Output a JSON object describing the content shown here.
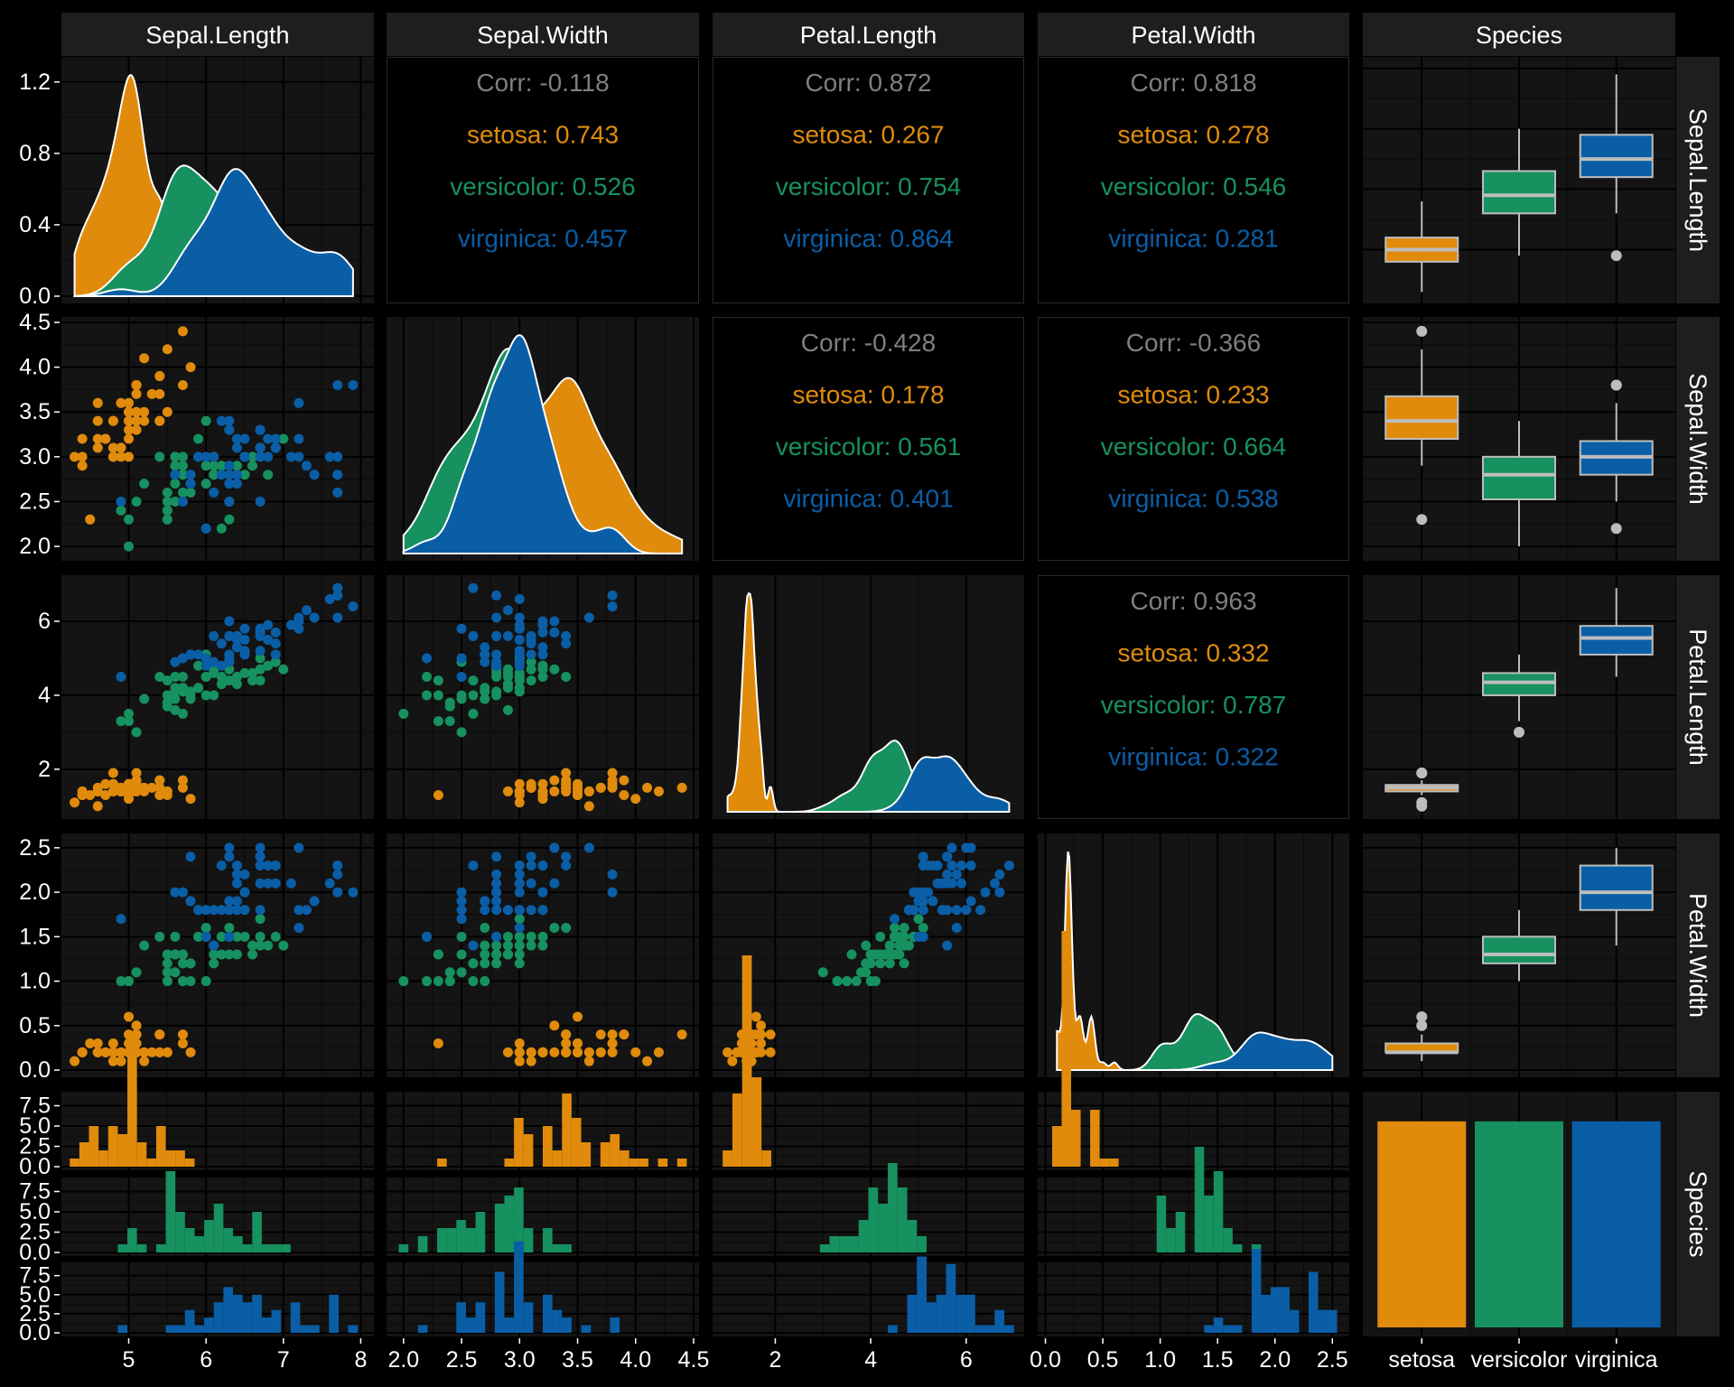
{
  "chart_data": {
    "type": "pairs",
    "variables": [
      "Sepal.Length",
      "Sepal.Width",
      "Petal.Length",
      "Petal.Width",
      "Species"
    ],
    "species": [
      "setosa",
      "versicolor",
      "virginica"
    ],
    "colors": {
      "setosa": "#e08b0c",
      "versicolor": "#16915f",
      "virginica": "#0a5ea6",
      "corr_overall": "#7f7f7f",
      "panel_bg": "#141414",
      "strip_bg": "#1e1e1e",
      "grid_major": "#000000",
      "grid_minor": "#0b0b0b",
      "page_bg": "#000000"
    },
    "correlations": [
      {
        "id": "sw-sl",
        "overall": "Corr: -0.118",
        "setosa": "setosa: 0.743",
        "versicolor": "versicolor: 0.526",
        "virginica": "virginica: 0.457"
      },
      {
        "id": "pl-sl",
        "overall": "Corr: 0.872",
        "setosa": "setosa: 0.267",
        "versicolor": "versicolor: 0.754",
        "virginica": "virginica: 0.864"
      },
      {
        "id": "pw-sl",
        "overall": "Corr: 0.818",
        "setosa": "setosa: 0.278",
        "versicolor": "versicolor: 0.546",
        "virginica": "virginica: 0.281"
      },
      {
        "id": "pl-sw",
        "overall": "Corr: -0.428",
        "setosa": "setosa: 0.178",
        "versicolor": "versicolor: 0.561",
        "virginica": "virginica: 0.401"
      },
      {
        "id": "pw-sw",
        "overall": "Corr: -0.366",
        "setosa": "setosa: 0.233",
        "versicolor": "versicolor: 0.664",
        "virginica": "virginica: 0.538"
      },
      {
        "id": "pw-pl",
        "overall": "Corr: 0.963",
        "setosa": "setosa: 0.332",
        "versicolor": "versicolor: 0.787",
        "virginica": "virginica: 0.322"
      }
    ],
    "axes": {
      "sl": {
        "range": [
          4.2,
          8.1
        ],
        "ticks": [
          5,
          6,
          7,
          8
        ],
        "labels": [
          "5",
          "6",
          "7",
          "8"
        ]
      },
      "sw": {
        "range": [
          1.9,
          4.5
        ],
        "ticks": [
          2.0,
          2.5,
          3.0,
          3.5,
          4.0,
          4.5
        ],
        "labels": [
          "2.0",
          "2.5",
          "3.0",
          "3.5",
          "4.0",
          "4.5"
        ]
      },
      "pl": {
        "range": [
          0.8,
          7.1
        ],
        "ticks": [
          2,
          4,
          6
        ],
        "labels": [
          "2",
          "4",
          "6"
        ]
      },
      "pw": {
        "range": [
          -0.02,
          2.6
        ],
        "ticks": [
          0.0,
          0.5,
          1.0,
          1.5,
          2.0,
          2.5
        ],
        "labels": [
          "0.0",
          "0.5",
          "1.0",
          "1.5",
          "2.0",
          "2.5"
        ]
      },
      "dens_sl": {
        "range": [
          0,
          1.3
        ],
        "ticks": [
          0.0,
          0.4,
          0.8,
          1.2
        ],
        "labels": [
          "0.0",
          "0.4",
          "0.8",
          "1.2"
        ]
      },
      "count": {
        "range": [
          0,
          9
        ],
        "ticks": [
          0.0,
          2.5,
          5.0,
          7.5
        ],
        "labels": [
          "0.0",
          "2.5",
          "5.0",
          "7.5"
        ]
      }
    },
    "species_axis_labels": [
      "setosa",
      "versicolor",
      "virginica"
    ],
    "species_counts": [
      50,
      50,
      50
    ],
    "boxplots": {
      "sl": {
        "setosa": [
          4.3,
          4.8,
          5.0,
          5.2,
          5.8
        ],
        "versicolor": [
          4.9,
          5.6,
          5.9,
          6.3,
          7.0
        ],
        "virginica": [
          5.6,
          6.2,
          6.5,
          6.9,
          7.9
        ]
      },
      "sw": {
        "setosa": [
          2.9,
          3.2,
          3.4,
          3.675,
          4.2
        ],
        "versicolor": [
          2.0,
          2.525,
          2.8,
          3.0,
          3.4
        ],
        "virginica": [
          2.5,
          2.8,
          3.0,
          3.175,
          3.6
        ]
      },
      "pl": {
        "setosa": [
          1.3,
          1.4,
          1.5,
          1.575,
          1.7
        ],
        "versicolor": [
          3.3,
          4.0,
          4.35,
          4.6,
          5.1
        ],
        "virginica": [
          4.5,
          5.1,
          5.55,
          5.875,
          6.9
        ]
      },
      "pw": {
        "setosa": [
          0.1,
          0.2,
          0.2,
          0.3,
          0.4
        ],
        "versicolor": [
          1.0,
          1.2,
          1.3,
          1.5,
          1.8
        ],
        "virginica": [
          1.4,
          1.8,
          2.0,
          2.3,
          2.5
        ]
      }
    },
    "box_outliers": {
      "sl": {
        "setosa": [],
        "versicolor": [],
        "virginica": [
          4.9
        ]
      },
      "sw": {
        "setosa": [
          2.3,
          4.4
        ],
        "versicolor": [],
        "virginica": [
          2.2,
          3.8,
          3.8
        ]
      },
      "pl": {
        "setosa": [
          1.0,
          1.1,
          1.9,
          1.9
        ],
        "versicolor": [
          3.0
        ],
        "virginica": []
      },
      "pw": {
        "setosa": [
          0.5,
          0.6
        ],
        "versicolor": [],
        "virginica": []
      }
    },
    "iris": {
      "setosa": [
        [
          5.1,
          3.5,
          1.4,
          0.2
        ],
        [
          4.9,
          3.0,
          1.4,
          0.2
        ],
        [
          4.7,
          3.2,
          1.3,
          0.2
        ],
        [
          4.6,
          3.1,
          1.5,
          0.2
        ],
        [
          5.0,
          3.6,
          1.4,
          0.2
        ],
        [
          5.4,
          3.9,
          1.7,
          0.4
        ],
        [
          4.6,
          3.4,
          1.4,
          0.3
        ],
        [
          5.0,
          3.4,
          1.5,
          0.2
        ],
        [
          4.4,
          2.9,
          1.4,
          0.2
        ],
        [
          4.9,
          3.1,
          1.5,
          0.1
        ],
        [
          5.4,
          3.7,
          1.5,
          0.2
        ],
        [
          4.8,
          3.4,
          1.6,
          0.2
        ],
        [
          4.8,
          3.0,
          1.4,
          0.1
        ],
        [
          4.3,
          3.0,
          1.1,
          0.1
        ],
        [
          5.8,
          4.0,
          1.2,
          0.2
        ],
        [
          5.7,
          4.4,
          1.5,
          0.4
        ],
        [
          5.4,
          3.9,
          1.3,
          0.4
        ],
        [
          5.1,
          3.5,
          1.4,
          0.3
        ],
        [
          5.7,
          3.8,
          1.7,
          0.3
        ],
        [
          5.1,
          3.8,
          1.5,
          0.3
        ],
        [
          5.4,
          3.4,
          1.7,
          0.2
        ],
        [
          5.1,
          3.7,
          1.5,
          0.4
        ],
        [
          4.6,
          3.6,
          1.0,
          0.2
        ],
        [
          5.1,
          3.3,
          1.7,
          0.5
        ],
        [
          4.8,
          3.4,
          1.9,
          0.2
        ],
        [
          5.0,
          3.0,
          1.6,
          0.2
        ],
        [
          5.0,
          3.4,
          1.6,
          0.4
        ],
        [
          5.2,
          3.5,
          1.5,
          0.2
        ],
        [
          5.2,
          3.4,
          1.4,
          0.2
        ],
        [
          4.7,
          3.2,
          1.6,
          0.2
        ],
        [
          4.8,
          3.1,
          1.6,
          0.2
        ],
        [
          5.4,
          3.4,
          1.5,
          0.4
        ],
        [
          5.2,
          4.1,
          1.5,
          0.1
        ],
        [
          5.5,
          4.2,
          1.4,
          0.2
        ],
        [
          4.9,
          3.1,
          1.5,
          0.2
        ],
        [
          5.0,
          3.2,
          1.2,
          0.2
        ],
        [
          5.5,
          3.5,
          1.3,
          0.2
        ],
        [
          4.9,
          3.6,
          1.4,
          0.1
        ],
        [
          4.4,
          3.0,
          1.3,
          0.2
        ],
        [
          5.1,
          3.4,
          1.5,
          0.2
        ],
        [
          5.0,
          3.5,
          1.3,
          0.3
        ],
        [
          4.5,
          2.3,
          1.3,
          0.3
        ],
        [
          4.4,
          3.2,
          1.3,
          0.2
        ],
        [
          5.0,
          3.5,
          1.6,
          0.6
        ],
        [
          5.1,
          3.8,
          1.9,
          0.4
        ],
        [
          4.8,
          3.0,
          1.4,
          0.3
        ],
        [
          5.1,
          3.8,
          1.6,
          0.2
        ],
        [
          4.6,
          3.2,
          1.4,
          0.2
        ],
        [
          5.3,
          3.7,
          1.5,
          0.2
        ],
        [
          5.0,
          3.3,
          1.4,
          0.2
        ]
      ],
      "versicolor": [
        [
          7.0,
          3.2,
          4.7,
          1.4
        ],
        [
          6.4,
          3.2,
          4.5,
          1.5
        ],
        [
          6.9,
          3.1,
          4.9,
          1.5
        ],
        [
          5.5,
          2.3,
          4.0,
          1.3
        ],
        [
          6.5,
          2.8,
          4.6,
          1.5
        ],
        [
          5.7,
          2.8,
          4.5,
          1.3
        ],
        [
          6.3,
          3.3,
          4.7,
          1.6
        ],
        [
          4.9,
          2.4,
          3.3,
          1.0
        ],
        [
          6.6,
          2.9,
          4.6,
          1.3
        ],
        [
          5.2,
          2.7,
          3.9,
          1.4
        ],
        [
          5.0,
          2.0,
          3.5,
          1.0
        ],
        [
          5.9,
          3.0,
          4.2,
          1.5
        ],
        [
          6.0,
          2.2,
          4.0,
          1.0
        ],
        [
          6.1,
          2.9,
          4.7,
          1.4
        ],
        [
          5.6,
          2.9,
          3.6,
          1.3
        ],
        [
          6.7,
          3.1,
          4.4,
          1.4
        ],
        [
          5.6,
          3.0,
          4.5,
          1.5
        ],
        [
          5.8,
          2.7,
          4.1,
          1.0
        ],
        [
          6.2,
          2.2,
          4.5,
          1.5
        ],
        [
          5.6,
          2.5,
          3.9,
          1.1
        ],
        [
          5.9,
          3.2,
          4.8,
          1.8
        ],
        [
          6.1,
          2.8,
          4.0,
          1.3
        ],
        [
          6.3,
          2.5,
          4.9,
          1.5
        ],
        [
          6.1,
          2.8,
          4.7,
          1.2
        ],
        [
          6.4,
          2.9,
          4.3,
          1.3
        ],
        [
          6.6,
          3.0,
          4.4,
          1.4
        ],
        [
          6.8,
          2.8,
          4.8,
          1.4
        ],
        [
          6.7,
          3.0,
          5.0,
          1.7
        ],
        [
          6.0,
          2.9,
          4.5,
          1.5
        ],
        [
          5.7,
          2.6,
          3.5,
          1.0
        ],
        [
          5.5,
          2.4,
          3.8,
          1.1
        ],
        [
          5.5,
          2.4,
          3.7,
          1.0
        ],
        [
          5.8,
          2.7,
          3.9,
          1.2
        ],
        [
          6.0,
          2.7,
          5.1,
          1.6
        ],
        [
          5.4,
          3.0,
          4.5,
          1.5
        ],
        [
          6.0,
          3.4,
          4.5,
          1.6
        ],
        [
          6.7,
          3.1,
          4.7,
          1.5
        ],
        [
          6.3,
          2.3,
          4.4,
          1.3
        ],
        [
          5.6,
          3.0,
          4.1,
          1.3
        ],
        [
          5.5,
          2.5,
          4.0,
          1.3
        ],
        [
          5.5,
          2.6,
          4.4,
          1.2
        ],
        [
          6.1,
          3.0,
          4.6,
          1.4
        ],
        [
          5.8,
          2.6,
          4.0,
          1.2
        ],
        [
          5.0,
          2.3,
          3.3,
          1.0
        ],
        [
          5.6,
          2.7,
          4.2,
          1.3
        ],
        [
          5.7,
          3.0,
          4.2,
          1.2
        ],
        [
          5.7,
          2.9,
          4.2,
          1.3
        ],
        [
          6.2,
          2.9,
          4.3,
          1.3
        ],
        [
          5.1,
          2.5,
          3.0,
          1.1
        ],
        [
          5.7,
          2.8,
          4.1,
          1.3
        ]
      ],
      "virginica": [
        [
          6.3,
          3.3,
          6.0,
          2.5
        ],
        [
          5.8,
          2.7,
          5.1,
          1.9
        ],
        [
          7.1,
          3.0,
          5.9,
          2.1
        ],
        [
          6.3,
          2.9,
          5.6,
          1.8
        ],
        [
          6.5,
          3.0,
          5.8,
          2.2
        ],
        [
          7.6,
          3.0,
          6.6,
          2.1
        ],
        [
          4.9,
          2.5,
          4.5,
          1.7
        ],
        [
          7.3,
          2.9,
          6.3,
          1.8
        ],
        [
          6.7,
          2.5,
          5.8,
          1.8
        ],
        [
          7.2,
          3.6,
          6.1,
          2.5
        ],
        [
          6.5,
          3.2,
          5.1,
          2.0
        ],
        [
          6.4,
          2.7,
          5.3,
          1.9
        ],
        [
          6.8,
          3.0,
          5.5,
          2.1
        ],
        [
          5.7,
          2.5,
          5.0,
          2.0
        ],
        [
          5.8,
          2.8,
          5.1,
          2.4
        ],
        [
          6.4,
          3.2,
          5.3,
          2.3
        ],
        [
          6.5,
          3.0,
          5.5,
          1.8
        ],
        [
          7.7,
          3.8,
          6.7,
          2.2
        ],
        [
          7.7,
          2.6,
          6.9,
          2.3
        ],
        [
          6.0,
          2.2,
          5.0,
          1.5
        ],
        [
          6.9,
          3.2,
          5.7,
          2.3
        ],
        [
          5.6,
          2.8,
          4.9,
          2.0
        ],
        [
          7.7,
          2.8,
          6.7,
          2.0
        ],
        [
          6.3,
          2.7,
          4.9,
          1.8
        ],
        [
          6.7,
          3.3,
          5.7,
          2.1
        ],
        [
          7.2,
          3.2,
          6.0,
          1.8
        ],
        [
          6.2,
          2.8,
          4.8,
          1.8
        ],
        [
          6.1,
          3.0,
          4.9,
          1.8
        ],
        [
          6.4,
          2.8,
          5.6,
          2.1
        ],
        [
          7.2,
          3.0,
          5.8,
          1.6
        ],
        [
          7.4,
          2.8,
          6.1,
          1.9
        ],
        [
          7.9,
          3.8,
          6.4,
          2.0
        ],
        [
          6.4,
          2.8,
          5.6,
          2.2
        ],
        [
          6.3,
          2.8,
          5.1,
          1.5
        ],
        [
          6.1,
          2.6,
          5.6,
          1.4
        ],
        [
          7.7,
          3.0,
          6.1,
          2.3
        ],
        [
          6.3,
          3.4,
          5.6,
          2.4
        ],
        [
          6.4,
          3.1,
          5.5,
          1.8
        ],
        [
          6.0,
          3.0,
          4.8,
          1.8
        ],
        [
          6.9,
          3.1,
          5.4,
          2.1
        ],
        [
          6.7,
          3.1,
          5.6,
          2.4
        ],
        [
          6.9,
          3.1,
          5.1,
          2.3
        ],
        [
          5.8,
          2.7,
          5.1,
          1.9
        ],
        [
          6.8,
          3.2,
          5.9,
          2.3
        ],
        [
          6.7,
          3.3,
          5.7,
          2.5
        ],
        [
          6.7,
          3.0,
          5.2,
          2.3
        ],
        [
          6.3,
          2.5,
          5.0,
          1.9
        ],
        [
          6.5,
          3.0,
          5.2,
          2.0
        ],
        [
          6.2,
          3.4,
          5.4,
          2.3
        ],
        [
          5.9,
          3.0,
          5.1,
          1.8
        ]
      ]
    }
  }
}
